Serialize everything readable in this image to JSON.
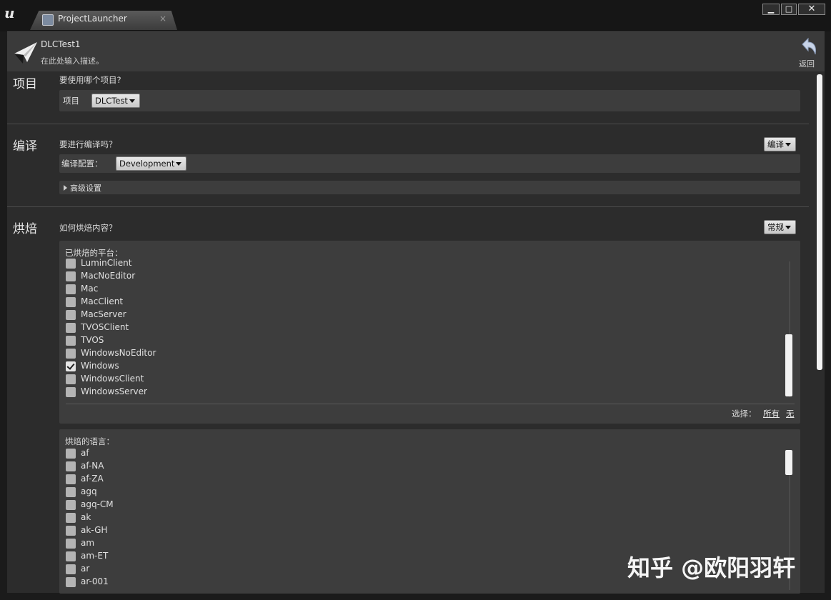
{
  "window": {
    "tab_title": "ProjectLauncher",
    "tab_close": "×",
    "min_label": "▬",
    "max_label": "□",
    "close_label": "✕"
  },
  "header": {
    "profile_name": "DLCTest1",
    "description": "在此处输入描述。",
    "back_label": "返回"
  },
  "project": {
    "section": "项目",
    "question": "要使用哪个项目?",
    "field_label": "项目",
    "value": "DLCTest"
  },
  "build": {
    "section": "编译",
    "question": "要进行编译吗？",
    "mode_button": "编译",
    "config_label": "编译配置：",
    "config_value": "Development",
    "advanced": "高级设置"
  },
  "cook": {
    "section": "烘焙",
    "question": "如何烘焙内容？",
    "mode_button": "常规",
    "platforms_title": "已烘焙的平台：",
    "platforms": [
      {
        "name": "LuminClient",
        "checked": false
      },
      {
        "name": "MacNoEditor",
        "checked": false
      },
      {
        "name": "Mac",
        "checked": false
      },
      {
        "name": "MacClient",
        "checked": false
      },
      {
        "name": "MacServer",
        "checked": false
      },
      {
        "name": "TVOSClient",
        "checked": false
      },
      {
        "name": "TVOS",
        "checked": false
      },
      {
        "name": "WindowsNoEditor",
        "checked": false
      },
      {
        "name": "Windows",
        "checked": true
      },
      {
        "name": "WindowsClient",
        "checked": false
      },
      {
        "name": "WindowsServer",
        "checked": false
      }
    ],
    "select_label": "选择：",
    "select_all": "所有",
    "select_none": "无",
    "languages_title": "烘焙的语言：",
    "languages": [
      "af",
      "af-NA",
      "af-ZA",
      "agq",
      "agq-CM",
      "ak",
      "ak-GH",
      "am",
      "am-ET",
      "ar",
      "ar-001"
    ]
  },
  "watermark": "知乎 @欧阳羽轩"
}
